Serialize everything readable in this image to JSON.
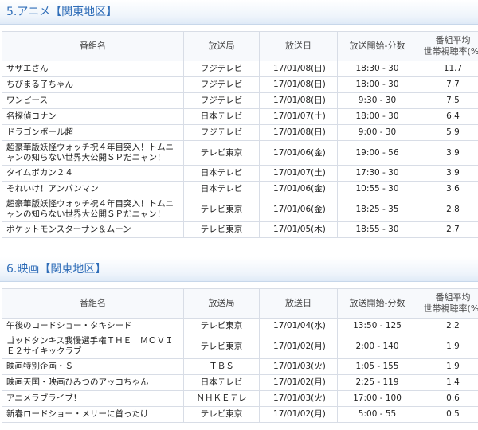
{
  "columns": [
    "番組名",
    "放送局",
    "放送日",
    "放送開始-分数",
    "番組平均",
    "世帯視聴率(%)"
  ],
  "sections": [
    {
      "heading_prefix": "5.アニメ",
      "heading_region": "【関東地区】",
      "rows": [
        [
          "サザエさん",
          "フジテレビ",
          "'17/01/08(日)",
          "18:30 - 30",
          "11.7"
        ],
        [
          "ちびまる子ちゃん",
          "フジテレビ",
          "'17/01/08(日)",
          "18:00 - 30",
          "7.7"
        ],
        [
          "ワンピース",
          "フジテレビ",
          "'17/01/08(日)",
          "9:30 - 30",
          "7.5"
        ],
        [
          "名探偵コナン",
          "日本テレビ",
          "'17/01/07(土)",
          "18:00 - 30",
          "6.4"
        ],
        [
          "ドラゴンボール超",
          "フジテレビ",
          "'17/01/08(日)",
          "9:00 - 30",
          "5.9"
        ],
        [
          "超豪華版妖怪ウォッチ祝４年目突入！トムニャンの知らない世界大公開ＳＰだニャン！",
          "テレビ東京",
          "'17/01/06(金)",
          "19:00 - 56",
          "3.9"
        ],
        [
          "タイムボカン２４",
          "日本テレビ",
          "'17/01/07(土)",
          "17:30 - 30",
          "3.9"
        ],
        [
          "それいけ！アンパンマン",
          "日本テレビ",
          "'17/01/06(金)",
          "10:55 - 30",
          "3.6"
        ],
        [
          "超豪華版妖怪ウォッチ祝４年目突入！トムニャンの知らない世界大公開ＳＰだニャン！",
          "テレビ東京",
          "'17/01/06(金)",
          "18:25 - 35",
          "2.8"
        ],
        [
          "ポケットモンスターサン＆ムーン",
          "テレビ東京",
          "'17/01/05(木)",
          "18:55 - 30",
          "2.7"
        ]
      ]
    },
    {
      "heading_prefix": "6.映画",
      "heading_region": "【関東地区】",
      "rows": [
        [
          "午後のロードショー・タキシード",
          "テレビ東京",
          "'17/01/04(水)",
          "13:50 - 125",
          "2.2"
        ],
        [
          "ゴッドタンキス我慢選手権ＴＨＥ　ＭＯＶＩＥ２サイキックラブ",
          "テレビ東京",
          "'17/01/02(月)",
          "2:00 - 140",
          "1.9"
        ],
        [
          "映画特別企画・Ｓ",
          "ＴＢＳ",
          "'17/01/03(火)",
          "1:05 - 155",
          "1.9"
        ],
        [
          "映画天国・映画ひみつのアッコちゃん",
          "日本テレビ",
          "'17/01/02(月)",
          "2:25 - 119",
          "1.4"
        ],
        [
          "アニメラブライブ！",
          "ＮＨＫＥテレ",
          "'17/01/03(火)",
          "17:00 - 100",
          "0.6"
        ],
        [
          "新春ロードショー・メリーに首ったけ",
          "テレビ東京",
          "'17/01/02(月)",
          "5:00 - 55",
          "0.5"
        ]
      ]
    }
  ],
  "highlight": {
    "section": 1,
    "row": 4,
    "color": "#d9252a"
  }
}
